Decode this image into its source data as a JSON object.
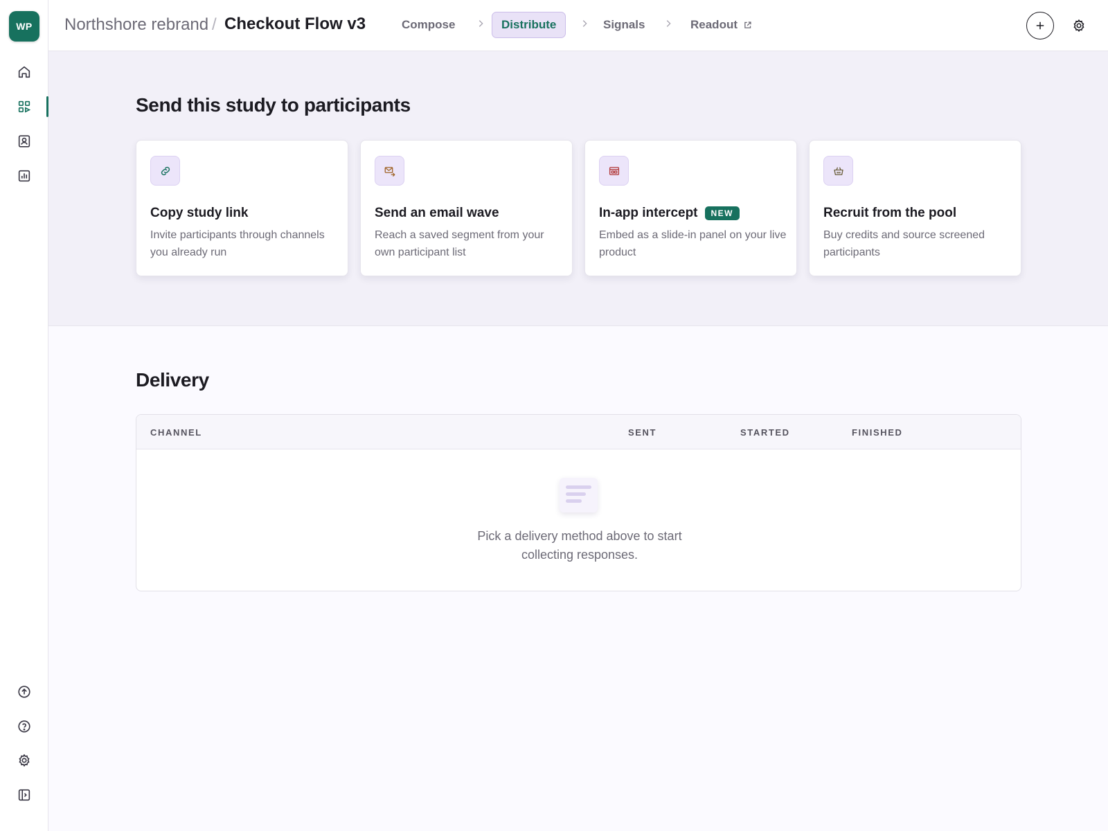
{
  "app": {
    "logo_text": "WP",
    "brand_color": "#17715e",
    "accent_color": "#e9e2f7"
  },
  "sidebar": {
    "top_items": [
      {
        "icon": "home-icon"
      },
      {
        "icon": "grid-icon",
        "active": true
      },
      {
        "icon": "contact-icon"
      },
      {
        "icon": "chart-icon"
      }
    ],
    "bottom_items": [
      {
        "icon": "upload-icon"
      },
      {
        "icon": "help-icon"
      },
      {
        "icon": "gear-icon"
      },
      {
        "icon": "collapse-sidebar-icon"
      }
    ]
  },
  "header": {
    "breadcrumb_parent": "Northshore rebrand",
    "breadcrumb_separator": "/",
    "breadcrumb_current": "Checkout Flow v3",
    "steps": [
      {
        "label": "Compose"
      },
      {
        "label": "Distribute",
        "active": true
      },
      {
        "label": "Signals"
      },
      {
        "label": "Readout",
        "external": true
      }
    ]
  },
  "distribute": {
    "title": "Send this study to participants",
    "options": [
      {
        "title": "Copy study link",
        "description": "Invite participants through channels you already run",
        "icon": "link-icon"
      },
      {
        "title": "Send an email wave",
        "description": "Reach a saved segment from your own participant list",
        "icon": "mail-send-icon"
      },
      {
        "title": "In-app intercept",
        "badge": "NEW",
        "description": "Embed as a slide-in panel on your live product",
        "icon": "app-window-icon"
      },
      {
        "title": "Recruit from the pool",
        "description": "Buy credits and source screened participants",
        "icon": "basket-icon"
      }
    ]
  },
  "delivery": {
    "title": "Delivery",
    "columns": [
      "CHANNEL",
      "SENT",
      "STARTED",
      "FINISHED"
    ],
    "rows": [],
    "empty_line1": "Pick a delivery method above to start",
    "empty_line2": "collecting responses."
  }
}
